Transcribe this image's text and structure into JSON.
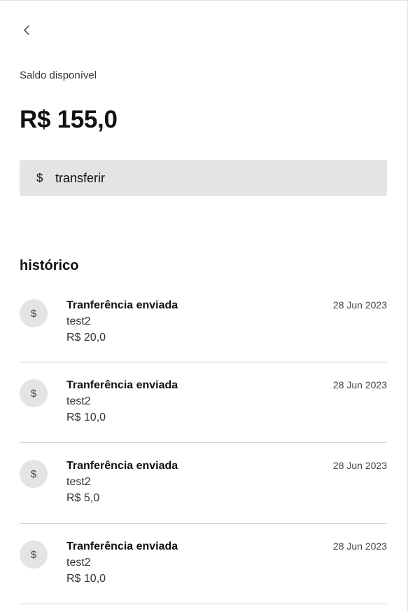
{
  "header": {
    "back_icon": "chevron-left-icon"
  },
  "balance": {
    "label": "Saldo disponível",
    "value": "R$ 155,0"
  },
  "transfer_button": {
    "icon": "$",
    "label": "transferir"
  },
  "history": {
    "title": "histórico",
    "items": [
      {
        "icon": "$",
        "title": "Tranferência enviada",
        "recipient": "test2",
        "amount": "R$ 20,0",
        "date": "28 Jun 2023"
      },
      {
        "icon": "$",
        "title": "Tranferência enviada",
        "recipient": "test2",
        "amount": "R$ 10,0",
        "date": "28 Jun 2023"
      },
      {
        "icon": "$",
        "title": "Tranferência enviada",
        "recipient": "test2",
        "amount": "R$ 5,0",
        "date": "28 Jun 2023"
      },
      {
        "icon": "$",
        "title": "Tranferência enviada",
        "recipient": "test2",
        "amount": "R$ 10,0",
        "date": "28 Jun 2023"
      }
    ]
  }
}
